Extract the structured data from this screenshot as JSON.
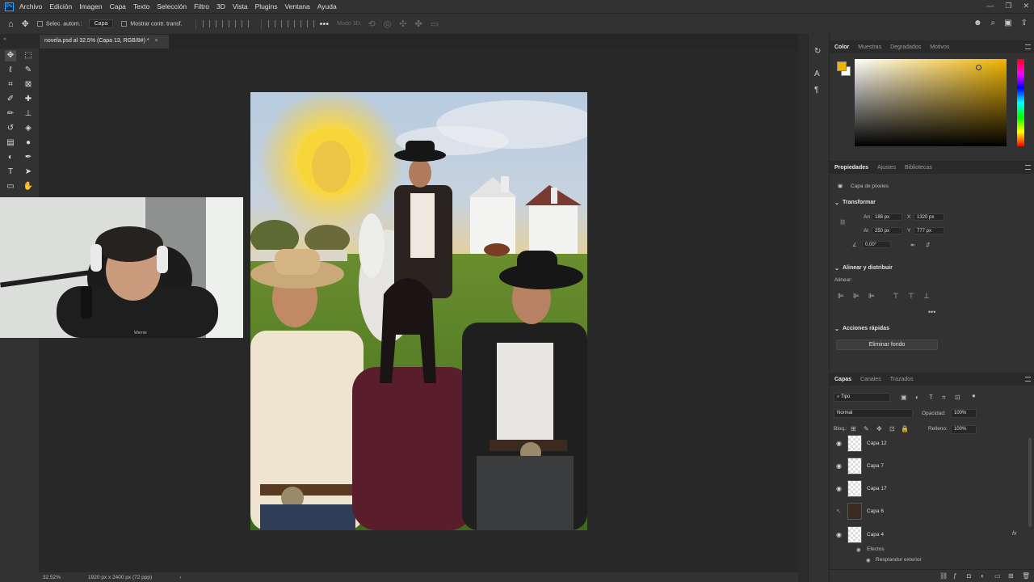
{
  "app": {
    "name": "Photoshop",
    "logo_text": "Ps"
  },
  "menu": [
    "Archivo",
    "Edición",
    "Imagen",
    "Capa",
    "Texto",
    "Selección",
    "Filtro",
    "3D",
    "Vista",
    "Plugins",
    "Ventana",
    "Ayuda"
  ],
  "options_bar": {
    "auto_select_label": "Selec. autom.:",
    "auto_select_value": "Capa",
    "show_transform_label": "Mostrar contr. transf.",
    "mode_3d_label": "Modo 3D:"
  },
  "document": {
    "tab_title": "novela.psd al 32.5% (Capa 13, RGB/8#) *",
    "close_glyph": "×"
  },
  "status_bar": {
    "zoom": "32.52%",
    "doc_info": "1920 px x 2400 px (72 ppp)",
    "arrow": "›"
  },
  "color_panel": {
    "tabs": [
      "Color",
      "Muestras",
      "Degradados",
      "Motivos"
    ],
    "active_tab": "Color",
    "foreground": "#f0b400",
    "background": "#ffffff",
    "hue_color": "#f0b400"
  },
  "properties_panel": {
    "tabs": [
      "Propiedades",
      "Ajustes",
      "Bibliotecas"
    ],
    "active_tab": "Propiedades",
    "layer_type": "Capa de píxeles",
    "transform": {
      "title": "Transformar",
      "width_label": "An",
      "width": "188 px",
      "x_label": "X",
      "x": "1320 px",
      "height_label": "Al",
      "height": "250 px",
      "y_label": "Y",
      "y": "777 px",
      "angle": "0,00°"
    },
    "align": {
      "title": "Alinear y distribuir",
      "sub": "Alinear:"
    },
    "quick_actions": {
      "title": "Acciones rápidas",
      "remove_bg": "Eliminar fondo"
    }
  },
  "layers_panel": {
    "tabs": [
      "Capas",
      "Canales",
      "Trazados"
    ],
    "active_tab": "Capas",
    "filter": "Tipo",
    "blend_mode": "Normal",
    "opacity_label": "Opacidad:",
    "opacity": "100%",
    "lock_label": "Bloq.:",
    "fill_label": "Relleno:",
    "fill": "100%",
    "layers": [
      {
        "name": "Capa 12",
        "visible": true
      },
      {
        "name": "Capa 7",
        "visible": true
      },
      {
        "name": "Capa 17",
        "visible": true
      },
      {
        "name": "Capa 6",
        "visible": false
      },
      {
        "name": "Capa 4",
        "visible": true,
        "fx": "fx"
      }
    ],
    "effects_label": "Efectos",
    "effect_item": "Resplandor exterior"
  },
  "webcam": {
    "shirt_text": "Wernie"
  },
  "icons": {
    "home": "home-icon",
    "move": "move-icon",
    "search": "search-icon",
    "share": "share-icon",
    "eye": "eye-icon",
    "trash": "trash-icon"
  }
}
